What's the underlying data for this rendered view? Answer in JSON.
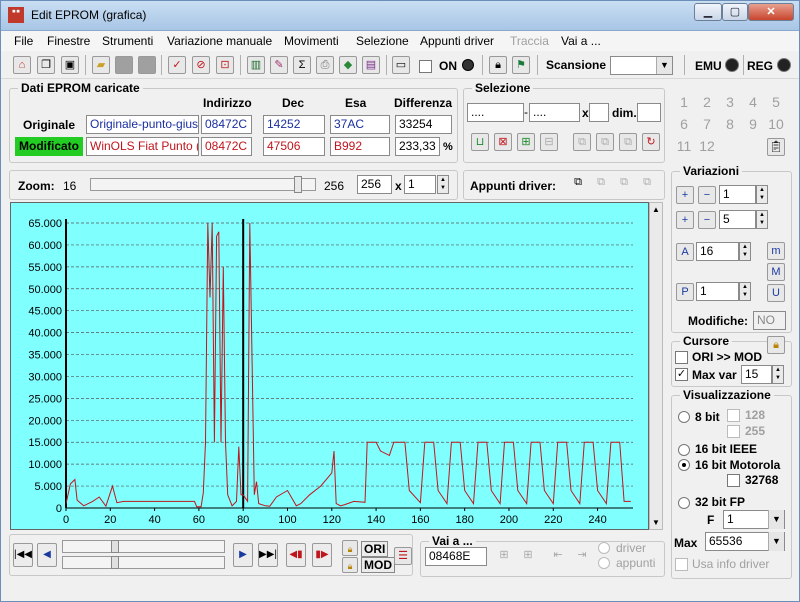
{
  "window": {
    "title": "Edit EPROM (grafica)",
    "app_icon": "EPROM"
  },
  "menu": [
    "File",
    "Finestre",
    "Strumenti",
    "Variazione manuale",
    "Movimenti",
    "Selezione",
    "Appunti driver",
    "Traccia",
    "Vai a ..."
  ],
  "toolbar": {
    "on_label": "ON",
    "scansione_label": "Scansione",
    "emu_label": "EMU",
    "reg_label": "REG"
  },
  "dati": {
    "title": "Dati EPROM caricate",
    "headers": [
      "Indirizzo",
      "Dec",
      "Esa",
      "Differenza"
    ],
    "originale": {
      "label": "Originale",
      "name": "Originale-punto-giusep",
      "indirizzo": "08472C",
      "dec": "14252",
      "esa": "37AC",
      "diff": "33254"
    },
    "modificato": {
      "label": "Modificato",
      "name": "WinOLS Fiat Punto (DI",
      "indirizzo": "08472C",
      "dec": "47506",
      "esa": "B992",
      "diff": "233,33",
      "unit": "%"
    }
  },
  "selezione": {
    "title": "Selezione",
    "from": "....",
    "to": "....",
    "x_label": "x",
    "dim_label": "dim."
  },
  "zoom": {
    "label": "Zoom:",
    "min": "16",
    "max": "256",
    "value": "256",
    "x_label": "x",
    "mult": "1",
    "level": 0.95
  },
  "appunti_label": "Appunti driver:",
  "numbers": [
    "1",
    "2",
    "3",
    "4",
    "5",
    "6",
    "7",
    "8",
    "9",
    "10",
    "11",
    "12"
  ],
  "variazioni": {
    "title": "Variazioni",
    "v1": "1",
    "v2": "5",
    "v3": "16",
    "v4": "1",
    "modifiche_label": "Modifiche:",
    "modifiche_value": "NO"
  },
  "cursore": {
    "title": "Cursore",
    "ori_mod": "ORI >> MOD",
    "maxvar_label": "Max var",
    "maxvar_value": "15"
  },
  "visualizzazione": {
    "title": "Visualizzazione",
    "bit8": "8 bit",
    "v128": "128",
    "v255": "255",
    "ieee": "16 bit IEEE",
    "motorola": "16 bit Motorola",
    "v32768": "32768",
    "fp": "32 bit FP",
    "f_label": "F",
    "f_value": "1",
    "max_label": "Max",
    "max_value": "65536",
    "usa_info": "Usa info driver"
  },
  "bottom": {
    "ori": "ORI",
    "mod": "MOD",
    "vai_label": "Vai a ...",
    "vai_value": "08468E",
    "driver": "driver",
    "appunti": "appunti"
  },
  "chart_data": {
    "type": "line",
    "xlim": [
      0,
      256
    ],
    "ylim": [
      0,
      65000
    ],
    "x_ticks": [
      0,
      20,
      40,
      60,
      80,
      100,
      120,
      140,
      160,
      180,
      200,
      220,
      240
    ],
    "y_ticks": [
      "0",
      "5.000",
      "10.000",
      "15.000",
      "20.000",
      "25.000",
      "30.000",
      "35.000",
      "40.000",
      "45.000",
      "50.000",
      "55.000",
      "60.000",
      "65.000"
    ],
    "grid": true,
    "cursor_x": 80,
    "series": [
      {
        "color": "#c0151d",
        "points": [
          [
            0,
            1000
          ],
          [
            2,
            5500
          ],
          [
            4,
            6500
          ],
          [
            5,
            1800
          ],
          [
            8,
            500
          ],
          [
            12,
            1500
          ],
          [
            15,
            2500
          ],
          [
            18,
            400
          ],
          [
            20,
            3500
          ],
          [
            21,
            5000
          ],
          [
            23,
            1200
          ],
          [
            26,
            1500
          ],
          [
            40,
            1500
          ],
          [
            55,
            1500
          ],
          [
            58,
            1500
          ],
          [
            59,
            300
          ],
          [
            61,
            300
          ],
          [
            62,
            3500
          ],
          [
            63,
            15000
          ],
          [
            64,
            65000
          ],
          [
            65,
            48000
          ],
          [
            66,
            65000
          ],
          [
            67,
            15000
          ],
          [
            68,
            62000
          ],
          [
            69,
            63000
          ],
          [
            70,
            15000
          ],
          [
            71,
            55000
          ],
          [
            72,
            15000
          ],
          [
            73,
            3000
          ],
          [
            75,
            500
          ],
          [
            77,
            1500
          ],
          [
            78,
            14000
          ],
          [
            79,
            3000
          ],
          [
            80,
            3000
          ],
          [
            82,
            1500
          ],
          [
            83,
            65000
          ],
          [
            85,
            3000
          ],
          [
            86,
            6000
          ],
          [
            87,
            1000
          ],
          [
            90,
            500
          ],
          [
            92,
            400
          ],
          [
            95,
            2500
          ],
          [
            100,
            4000
          ],
          [
            104,
            500
          ],
          [
            106,
            1000
          ],
          [
            110,
            3000
          ],
          [
            115,
            5000
          ],
          [
            120,
            8000
          ],
          [
            121,
            13000
          ],
          [
            122,
            1000
          ],
          [
            124,
            500
          ],
          [
            126,
            800
          ],
          [
            130,
            1500
          ],
          [
            135,
            1300
          ],
          [
            136,
            15000
          ],
          [
            140,
            15000
          ],
          [
            142,
            13000
          ],
          [
            146,
            12000
          ],
          [
            148,
            15000
          ],
          [
            153,
            15000
          ],
          [
            155,
            4000
          ],
          [
            160,
            1200
          ],
          [
            162,
            15000
          ],
          [
            166,
            15000
          ],
          [
            168,
            4000
          ],
          [
            172,
            1000
          ],
          [
            174,
            15000
          ],
          [
            178,
            15000
          ],
          [
            180,
            4000
          ],
          [
            184,
            1000
          ],
          [
            186,
            15000
          ],
          [
            190,
            15000
          ],
          [
            192,
            4000
          ],
          [
            196,
            1000
          ],
          [
            198,
            15000
          ],
          [
            202,
            15000
          ],
          [
            204,
            4000
          ],
          [
            208,
            1000
          ],
          [
            210,
            15000
          ],
          [
            214,
            15000
          ],
          [
            216,
            4000
          ],
          [
            220,
            1000
          ],
          [
            222,
            15000
          ],
          [
            226,
            15000
          ],
          [
            228,
            4000
          ],
          [
            232,
            1000
          ],
          [
            234,
            15000
          ],
          [
            238,
            15000
          ],
          [
            240,
            4000
          ],
          [
            244,
            1000
          ],
          [
            246,
            15000
          ],
          [
            250,
            15000
          ],
          [
            252,
            1500
          ],
          [
            255,
            1500
          ]
        ]
      }
    ]
  }
}
